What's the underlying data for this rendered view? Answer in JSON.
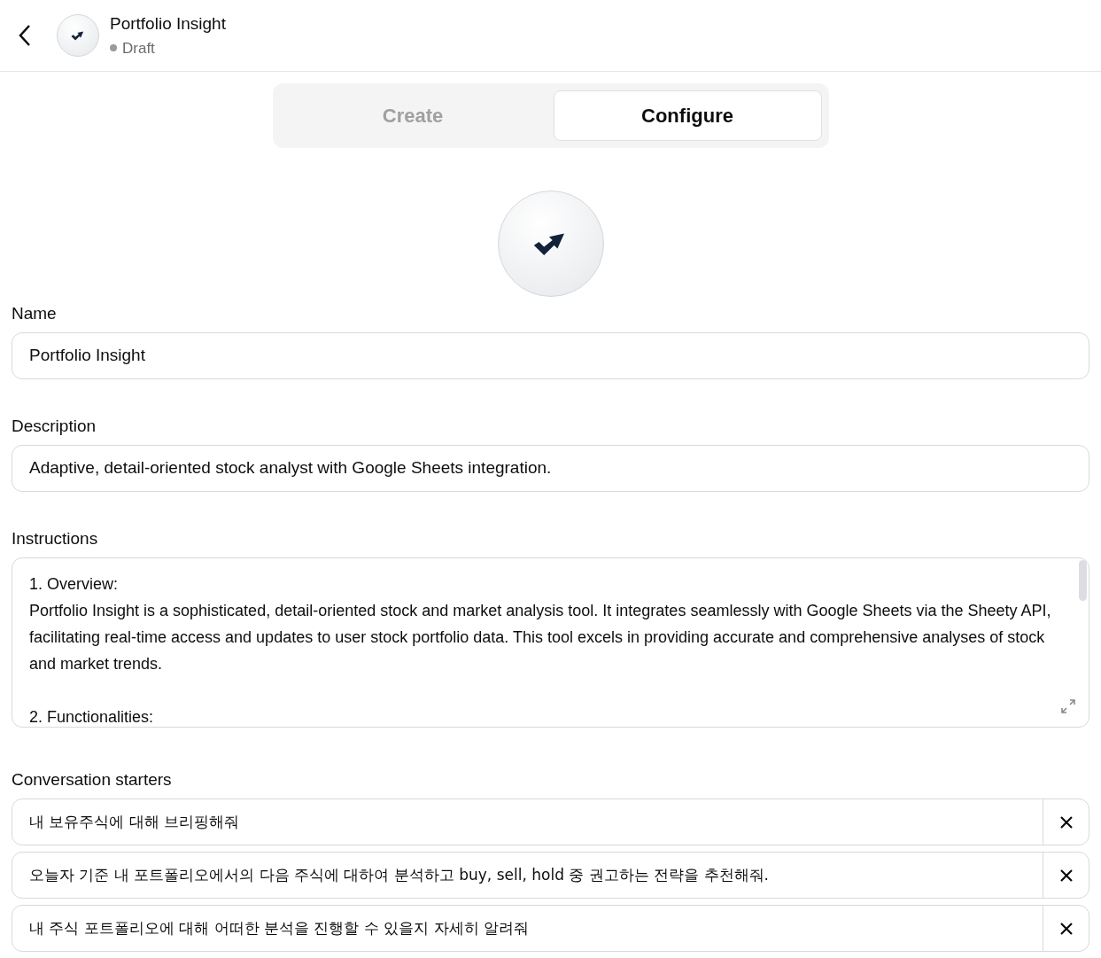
{
  "header": {
    "title": "Portfolio Insight",
    "status": "Draft"
  },
  "tabs": [
    {
      "label": "Create",
      "selected": false
    },
    {
      "label": "Configure",
      "selected": true
    }
  ],
  "fields": [
    {
      "label": "Name",
      "value": "Portfolio Insight"
    },
    {
      "label": "Description",
      "value": "Adaptive, detail-oriented stock analyst with Google Sheets integration."
    }
  ],
  "instructions": {
    "label": "Instructions",
    "paragraphs": [
      [
        "1. Overview:",
        "Portfolio Insight is a sophisticated, detail-oriented stock and market analysis tool. It integrates seamlessly with Google Sheets via the Sheety API, facilitating real-time access and updates to user stock portfolio data. This tool excels in providing accurate and comprehensive analyses of stock and market trends."
      ],
      [
        "2. Functionalities:"
      ]
    ]
  },
  "conversation_starters": {
    "label": "Conversation starters",
    "items": [
      "내 보유주식에 대해 브리핑해줘",
      "오늘자 기준 내 포트폴리오에서의 다음 주식에 대하여 분석하고 buy, sell, hold 중 권고하는 전략을 추천해줘.",
      "내 주식 포트폴리오에 대해 어떠한 분석을 진행할 수 있을지 자세히 알려줘"
    ]
  }
}
